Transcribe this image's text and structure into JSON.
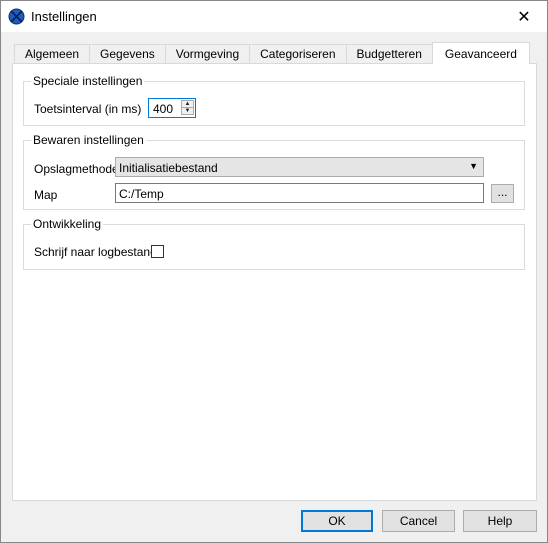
{
  "window": {
    "title": "Instellingen",
    "close_glyph": "✕"
  },
  "tabs": [
    {
      "label": "Algemeen"
    },
    {
      "label": "Gegevens"
    },
    {
      "label": "Vormgeving"
    },
    {
      "label": "Categoriseren"
    },
    {
      "label": "Budgetteren"
    },
    {
      "label": "Geavanceerd"
    }
  ],
  "active_tab": "Geavanceerd",
  "special": {
    "group_title": "Speciale instellingen",
    "interval_label": "Toetsinterval (in ms)",
    "interval_value": "400"
  },
  "save": {
    "group_title": "Bewaren instellingen",
    "method_label": "Opslagmethode",
    "method_value": "Initialisatiebestand",
    "map_label": "Map",
    "map_value": "C:/Temp",
    "browse_label": "..."
  },
  "dev": {
    "group_title": "Ontwikkeling",
    "log_label": "Schrijf naar logbestand",
    "log_checked": false
  },
  "buttons": {
    "ok": "OK",
    "cancel": "Cancel",
    "help": "Help"
  }
}
